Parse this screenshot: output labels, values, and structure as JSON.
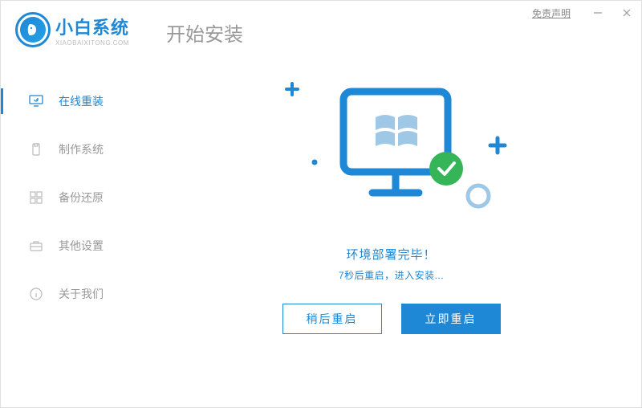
{
  "header": {
    "disclaimer": "免责声明",
    "brand": "小白系统",
    "brand_sub": "XIAOBAIXITONG.COM",
    "page_title": "开始安装"
  },
  "sidebar": {
    "items": [
      {
        "label": "在线重装"
      },
      {
        "label": "制作系统"
      },
      {
        "label": "备份还原"
      },
      {
        "label": "其他设置"
      },
      {
        "label": "关于我们"
      }
    ]
  },
  "content": {
    "status": "环境部署完毕！",
    "substatus": "7秒后重启，进入安装...",
    "later_button": "稍后重启",
    "now_button": "立即重启"
  },
  "colors": {
    "primary": "#1e87d6",
    "success": "#35b558"
  }
}
